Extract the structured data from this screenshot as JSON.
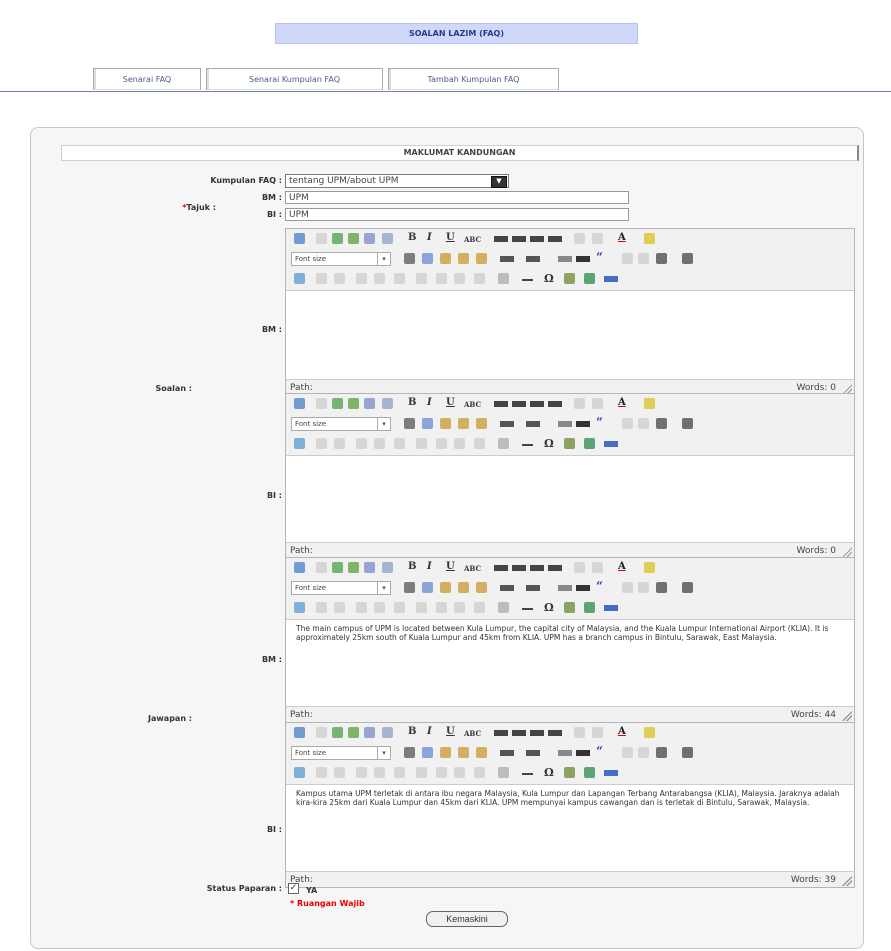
{
  "page": {
    "title": "SOALAN LAZIM (FAQ)"
  },
  "tabs": [
    {
      "label": "Senarai FAQ"
    },
    {
      "label": "Senarai Kumpulan FAQ"
    },
    {
      "label": "Tambah Kumpulan FAQ"
    }
  ],
  "section": {
    "header": "MAKLUMAT KANDUNGAN"
  },
  "form": {
    "group_label": "Kumpulan FAQ :",
    "group_value": "tentang UPM/about UPM",
    "required_mark": "*",
    "title_label": "Tajuk :",
    "title_bm_label": "BM :",
    "title_bm_value": "UPM",
    "title_bi_label": "BI :",
    "title_bi_value": "UPM",
    "question_label": "Soalan :",
    "answer_label": "Jawapan :",
    "lang_bm": "BM :",
    "lang_bi": "BI :",
    "status_label": "Status Paparan :",
    "status_checked_mark": "✓",
    "status_value": "YA",
    "required_note": "* Ruangan Wajib",
    "submit_label": "Kemaskini"
  },
  "editor": {
    "font_size_placeholder": "Font size",
    "path_label": "Path:",
    "bold": "B",
    "italic": "I",
    "underline": "U",
    "strike": "ABC",
    "quote": "“",
    "omega": "Ω",
    "font_color": "A"
  },
  "editors": [
    {
      "words": "Words: 0",
      "content": ""
    },
    {
      "words": "Words: 0",
      "content": ""
    },
    {
      "words": "Words: 44",
      "content": "The main campus of UPM is located between Kula Lumpur, the capital city of Malaysia, and the Kuala Lumpur International Airport (KLIA). It is approximately 25km south of Kuala Lumpur and 45km from KLIA. UPM has a branch campus in Bintulu, Sarawak, East Malaysia."
    },
    {
      "words": "Words: 39",
      "content": "Kampus utama UPM terletak di antara ibu negara Malaysia, Kula Lumpur dan Lapangan Terbang Antarabangsa (KLIA), Malaysia. Jaraknya adalah kira-kira 25km dari Kuala Lumpur dan 45km dari KLIA. UPM mempunyai kampus cawangan dan is terletak di Bintulu, Sarawak, Malaysia."
    }
  ],
  "colors": {
    "accent": "#cfd8fb",
    "required": "#ee0000",
    "tab_line": "#6d84b0"
  }
}
